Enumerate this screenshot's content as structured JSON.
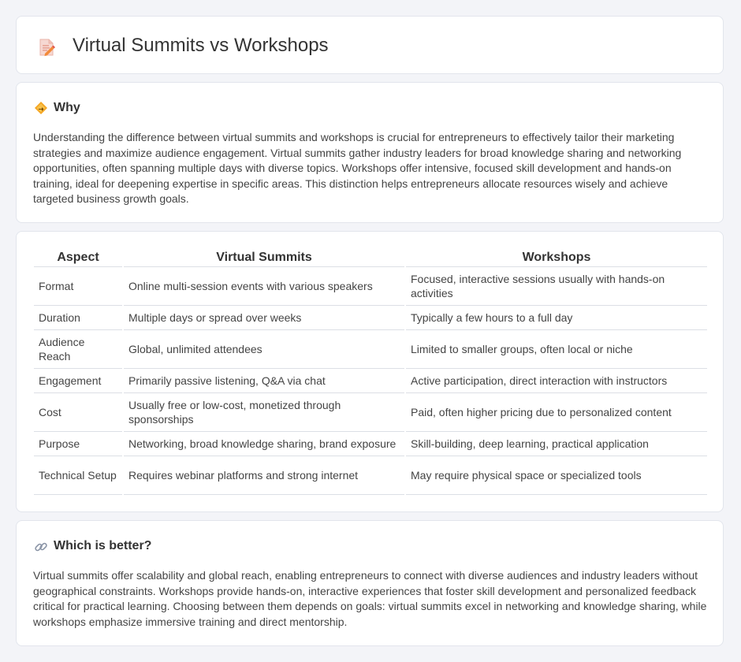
{
  "header": {
    "title": "Virtual Summits vs Workshops",
    "icon": "document-pencil-icon"
  },
  "why": {
    "heading": "Why",
    "icon": "diamond-sign-icon",
    "text": "Understanding the difference between virtual summits and workshops is crucial for entrepreneurs to effectively tailor their marketing strategies and maximize audience engagement. Virtual summits gather industry leaders for broad knowledge sharing and networking opportunities, often spanning multiple days with diverse topics. Workshops offer intensive, focused skill development and hands-on training, ideal for deepening expertise in specific areas. This distinction helps entrepreneurs allocate resources wisely and achieve targeted business growth goals."
  },
  "table": {
    "headers": [
      "Aspect",
      "Virtual Summits",
      "Workshops"
    ],
    "rows": [
      [
        "Format",
        "Online multi-session events with various speakers",
        "Focused, interactive sessions usually with hands-on activities"
      ],
      [
        "Duration",
        "Multiple days or spread over weeks",
        "Typically a few hours to a full day"
      ],
      [
        "Audience Reach",
        "Global, unlimited attendees",
        "Limited to smaller groups, often local or niche"
      ],
      [
        "Engagement",
        "Primarily passive listening, Q&A via chat",
        "Active participation, direct interaction with instructors"
      ],
      [
        "Cost",
        "Usually free or low-cost, monetized through sponsorships",
        "Paid, often higher pricing due to personalized content"
      ],
      [
        "Purpose",
        "Networking, broad knowledge sharing, brand exposure",
        "Skill-building, deep learning, practical application"
      ],
      [
        "Technical Setup",
        "Requires webinar platforms and strong internet",
        "May require physical space or specialized tools"
      ]
    ]
  },
  "better": {
    "heading": "Which is better?",
    "icon": "link-icon",
    "text": "Virtual summits offer scalability and global reach, enabling entrepreneurs to connect with diverse audiences and industry leaders without geographical constraints. Workshops provide hands-on, interactive experiences that foster skill development and personalized feedback critical for practical learning. Choosing between them depends on goals: virtual summits excel in networking and knowledge sharing, while workshops emphasize immersive training and direct mentorship."
  }
}
